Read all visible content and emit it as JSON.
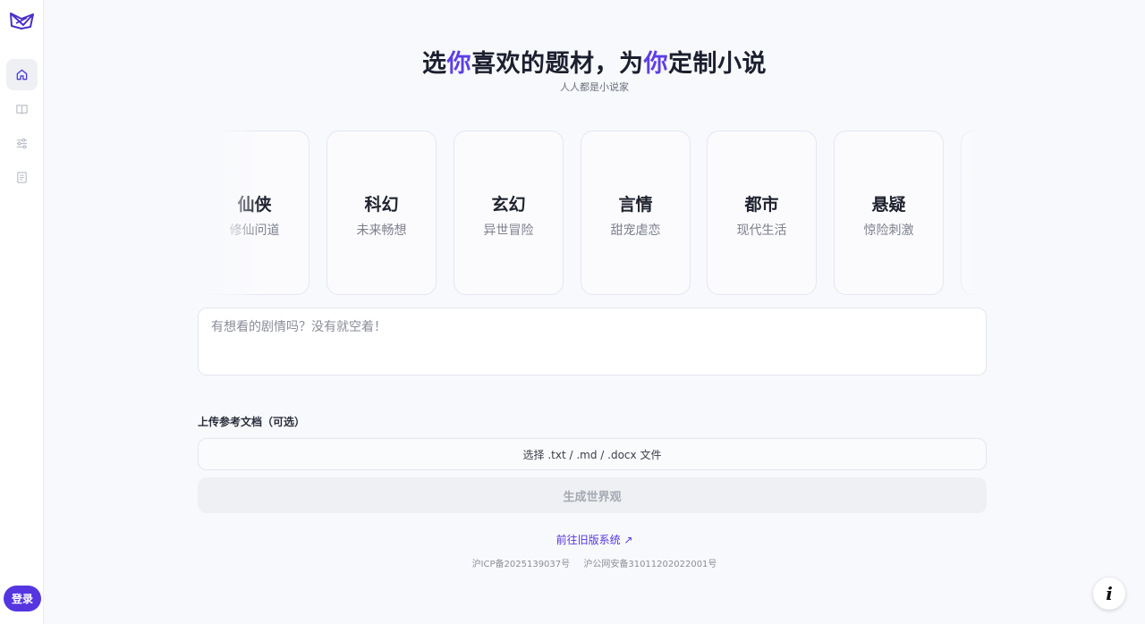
{
  "brand": {
    "logo_icon": "book-logo-icon",
    "accent": "#5535e0"
  },
  "sidebar": {
    "items": [
      {
        "icon": "home-icon",
        "active": true
      },
      {
        "icon": "book-icon",
        "active": false
      },
      {
        "icon": "sliders-icon",
        "active": false
      },
      {
        "icon": "document-icon",
        "active": false
      }
    ],
    "login_label": "登录"
  },
  "hero": {
    "title_part1": "选",
    "title_accent1": "你",
    "title_part2": "喜欢的题材，为",
    "title_accent2": "你",
    "title_part3": "定制小说",
    "subtitle": "人人都是小说家"
  },
  "genres": [
    {
      "title": "仙侠",
      "subtitle": "修仙问道"
    },
    {
      "title": "科幻",
      "subtitle": "未来畅想"
    },
    {
      "title": "玄幻",
      "subtitle": "异世冒险"
    },
    {
      "title": "言情",
      "subtitle": "甜宠虐恋"
    },
    {
      "title": "都市",
      "subtitle": "现代生活"
    },
    {
      "title": "悬疑",
      "subtitle": "惊险刺激"
    }
  ],
  "plot_input": {
    "placeholder": "有想看的剧情吗？没有就空着！",
    "value": ""
  },
  "upload": {
    "label": "上传参考文档（可选）",
    "button_label": "选择 .txt / .md / .docx 文件"
  },
  "generate_button": "生成世界观",
  "legacy_link": "前往旧版系统 ↗",
  "footer": {
    "icp": "沪ICP备2025139037号",
    "police": "沪公网安备31011202022001号"
  },
  "info_button": "i"
}
